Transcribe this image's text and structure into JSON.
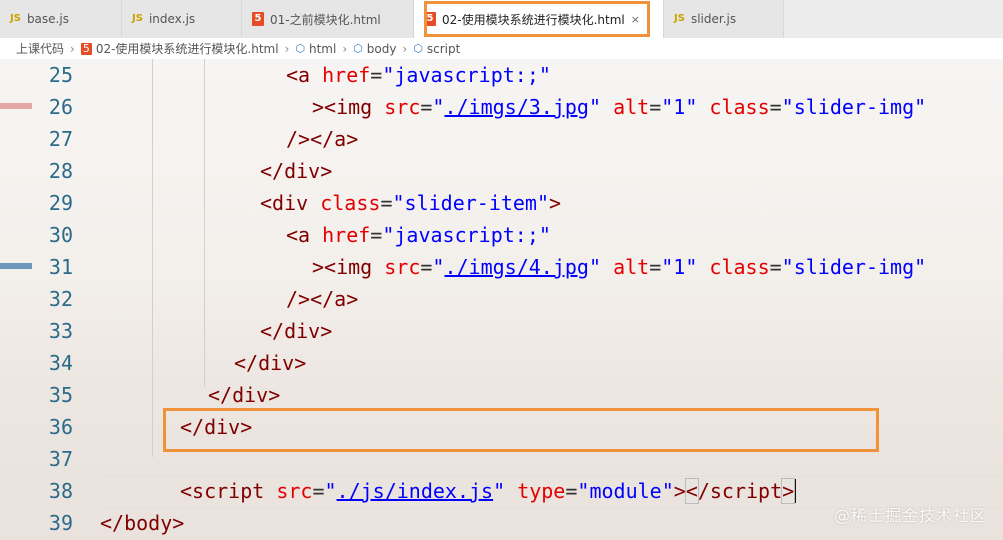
{
  "tabs": [
    {
      "label": "base.js",
      "icon": "js-file-icon",
      "width": 122
    },
    {
      "label": "index.js",
      "icon": "js-file-icon",
      "width": 120
    },
    {
      "label": "01-之前模块化.html",
      "icon": "html-file-icon",
      "width": 172
    },
    {
      "label": "02-使用模块系统进行模块化.html",
      "icon": "html-file-icon",
      "width": 250,
      "active": true,
      "close": "×"
    },
    {
      "label": "slider.js",
      "icon": "js-file-icon",
      "width": 120
    }
  ],
  "breadcrumb": {
    "root": "上课代码",
    "file": "02-使用模块系统进行模块化.html",
    "html": "html",
    "body": "body",
    "script": "script"
  },
  "lines": [
    {
      "n": "25",
      "indent": 7,
      "tokens": [
        [
          "tag",
          "<a "
        ],
        [
          "attr",
          "href"
        ],
        [
          "plain",
          "="
        ],
        [
          "str",
          "\"javascript:;\""
        ]
      ]
    },
    {
      "n": "26",
      "indent": 8,
      "tokens": [
        [
          "tag",
          "><img "
        ],
        [
          "attr",
          "src"
        ],
        [
          "plain",
          "="
        ],
        [
          "str",
          "\""
        ],
        [
          "str url",
          "./imgs/3.jpg"
        ],
        [
          "str",
          "\""
        ],
        [
          "plain",
          " "
        ],
        [
          "attr",
          "alt"
        ],
        [
          "plain",
          "="
        ],
        [
          "str",
          "\"1\""
        ],
        [
          "plain",
          " "
        ],
        [
          "attr",
          "class"
        ],
        [
          "plain",
          "="
        ],
        [
          "str",
          "\"slider-img\""
        ]
      ]
    },
    {
      "n": "27",
      "indent": 7,
      "tokens": [
        [
          "tag",
          "/></a>"
        ]
      ]
    },
    {
      "n": "28",
      "indent": 6,
      "tokens": [
        [
          "tag",
          "</div>"
        ]
      ]
    },
    {
      "n": "29",
      "indent": 6,
      "tokens": [
        [
          "tag",
          "<div "
        ],
        [
          "attr",
          "class"
        ],
        [
          "plain",
          "="
        ],
        [
          "str",
          "\"slider-item\""
        ],
        [
          "tag",
          ">"
        ]
      ]
    },
    {
      "n": "30",
      "indent": 7,
      "tokens": [
        [
          "tag",
          "<a "
        ],
        [
          "attr",
          "href"
        ],
        [
          "plain",
          "="
        ],
        [
          "str",
          "\"javascript:;\""
        ]
      ]
    },
    {
      "n": "31",
      "indent": 8,
      "tokens": [
        [
          "tag",
          "><img "
        ],
        [
          "attr",
          "src"
        ],
        [
          "plain",
          "="
        ],
        [
          "str",
          "\""
        ],
        [
          "str url",
          "./imgs/4.jpg"
        ],
        [
          "str",
          "\""
        ],
        [
          "plain",
          " "
        ],
        [
          "attr",
          "alt"
        ],
        [
          "plain",
          "="
        ],
        [
          "str",
          "\"1\""
        ],
        [
          "plain",
          " "
        ],
        [
          "attr",
          "class"
        ],
        [
          "plain",
          "="
        ],
        [
          "str",
          "\"slider-img\""
        ]
      ]
    },
    {
      "n": "32",
      "indent": 7,
      "tokens": [
        [
          "tag",
          "/></a>"
        ]
      ]
    },
    {
      "n": "33",
      "indent": 6,
      "tokens": [
        [
          "tag",
          "</div>"
        ]
      ]
    },
    {
      "n": "34",
      "indent": 5,
      "tokens": [
        [
          "tag",
          "</div>"
        ]
      ]
    },
    {
      "n": "35",
      "indent": 4,
      "tokens": [
        [
          "tag",
          "</div>"
        ]
      ]
    },
    {
      "n": "36",
      "indent": 3,
      "tokens": [
        [
          "tag",
          "</div>"
        ]
      ]
    },
    {
      "n": "37",
      "indent": 0,
      "tokens": []
    },
    {
      "n": "38",
      "indent": 3,
      "tokens": [
        [
          "tag",
          "<script "
        ],
        [
          "attr",
          "src"
        ],
        [
          "plain",
          "="
        ],
        [
          "str",
          "\""
        ],
        [
          "str url",
          "./js/index.js"
        ],
        [
          "str",
          "\""
        ],
        [
          "plain",
          " "
        ],
        [
          "attr",
          "type"
        ],
        [
          "plain",
          "="
        ],
        [
          "str",
          "\"module\""
        ],
        [
          "tag",
          ">"
        ],
        [
          "tag cursor-bracket",
          "<"
        ],
        [
          "tag",
          "/script"
        ],
        [
          "tag cursor-bracket",
          ">"
        ]
      ],
      "caret": true
    },
    {
      "n": "39",
      "indent": 0,
      "tokens": [
        [
          "tag",
          "</body>"
        ]
      ]
    }
  ],
  "watermark": "@稀土掘金技术社区",
  "colors": {
    "highlight": "#f0923a",
    "tag": "#800000",
    "attr": "#e50000",
    "string": "#0000ff",
    "line_number": "#2a6a8a"
  }
}
